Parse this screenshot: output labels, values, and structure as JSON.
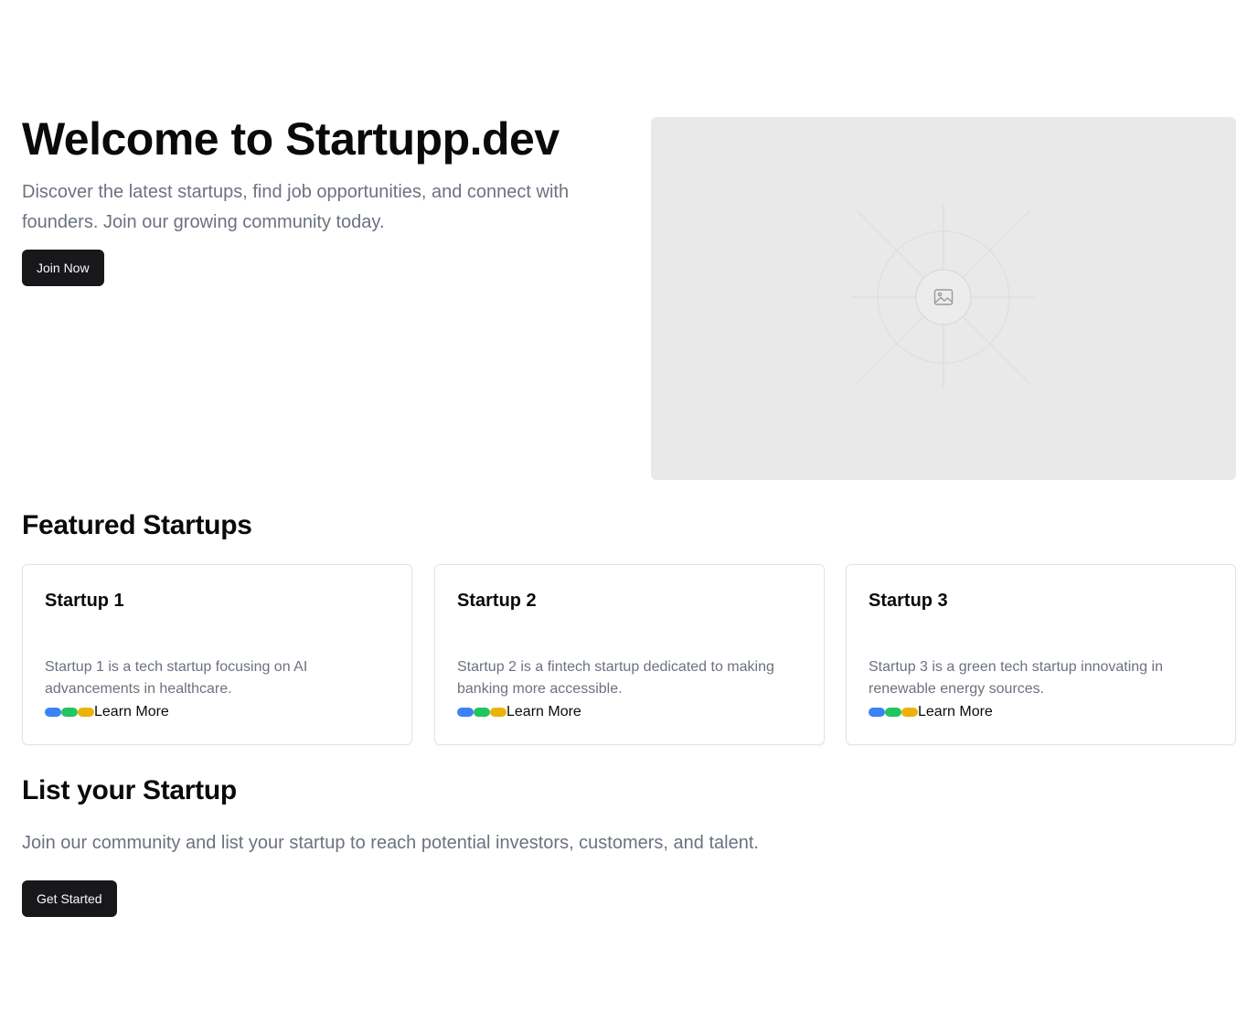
{
  "hero": {
    "title": "Welcome to Startupp.dev",
    "subtitle": "Discover the latest startups, find job opportunities, and connect with founders. Join our growing community today.",
    "button_label": "Join Now",
    "image_icon": "image-placeholder-icon"
  },
  "featured": {
    "title": "Featured Startups",
    "cards": [
      {
        "title": "Startup 1",
        "description": "Startup 1 is a tech startup focusing on AI advancements in healthcare.",
        "link_label": "Learn More"
      },
      {
        "title": "Startup 2",
        "description": "Startup 2 is a fintech startup dedicated to making banking more accessible.",
        "link_label": "Learn More"
      },
      {
        "title": "Startup 3",
        "description": "Startup 3 is a green tech startup innovating in renewable energy sources.",
        "link_label": "Learn More"
      }
    ],
    "tag_colors": [
      "#3b82f6",
      "#22c55e",
      "#eab308"
    ]
  },
  "list": {
    "title": "List your Startup",
    "subtitle": "Join our community and list your startup to reach potential investors, customers, and talent.",
    "button_label": "Get Started"
  },
  "colors": {
    "primary_button": "#18181b",
    "muted_text": "#6b7280",
    "image_bg": "#e9e9e9"
  }
}
